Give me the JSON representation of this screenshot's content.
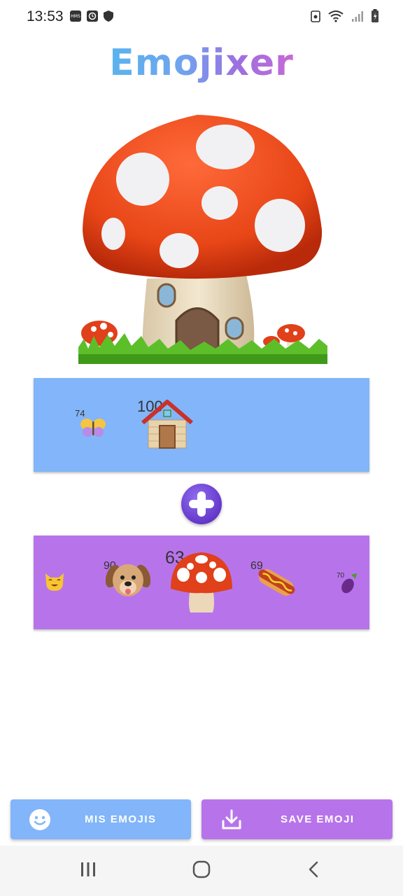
{
  "status_bar": {
    "time": "13:53",
    "left_icons": [
      "hms-icon",
      "clock-icon",
      "shield-icon"
    ],
    "right_icons": [
      "recycle-icon",
      "wifi-icon",
      "signal-icon",
      "battery-icon"
    ]
  },
  "app": {
    "title": "Emojixer"
  },
  "hero": {
    "icon": "mushroom-house-icon"
  },
  "top_panel": {
    "items": [
      {
        "icon": "butterfly-icon",
        "count": "74"
      },
      {
        "icon": "house-icon",
        "count": "100"
      }
    ]
  },
  "plus": {
    "icon": "plus-icon"
  },
  "bottom_panel": {
    "items": [
      {
        "icon": "cat-icon",
        "count": ""
      },
      {
        "icon": "dog-icon",
        "count": "90"
      },
      {
        "icon": "mushroom-icon",
        "count": "63"
      },
      {
        "icon": "hotdog-icon",
        "count": "69"
      },
      {
        "icon": "eggplant-icon",
        "count": "70"
      }
    ]
  },
  "buttons": {
    "mis_emojis": {
      "label": "MIS EMOJIS",
      "icon": "smiley-icon"
    },
    "save_emoji": {
      "label": "SAVE EMOJI",
      "icon": "download-icon"
    }
  },
  "nav": {
    "recents": "recents-icon",
    "home": "home-icon",
    "back": "back-icon"
  },
  "colors": {
    "blue": "#82b5fa",
    "purple": "#b774ea"
  }
}
